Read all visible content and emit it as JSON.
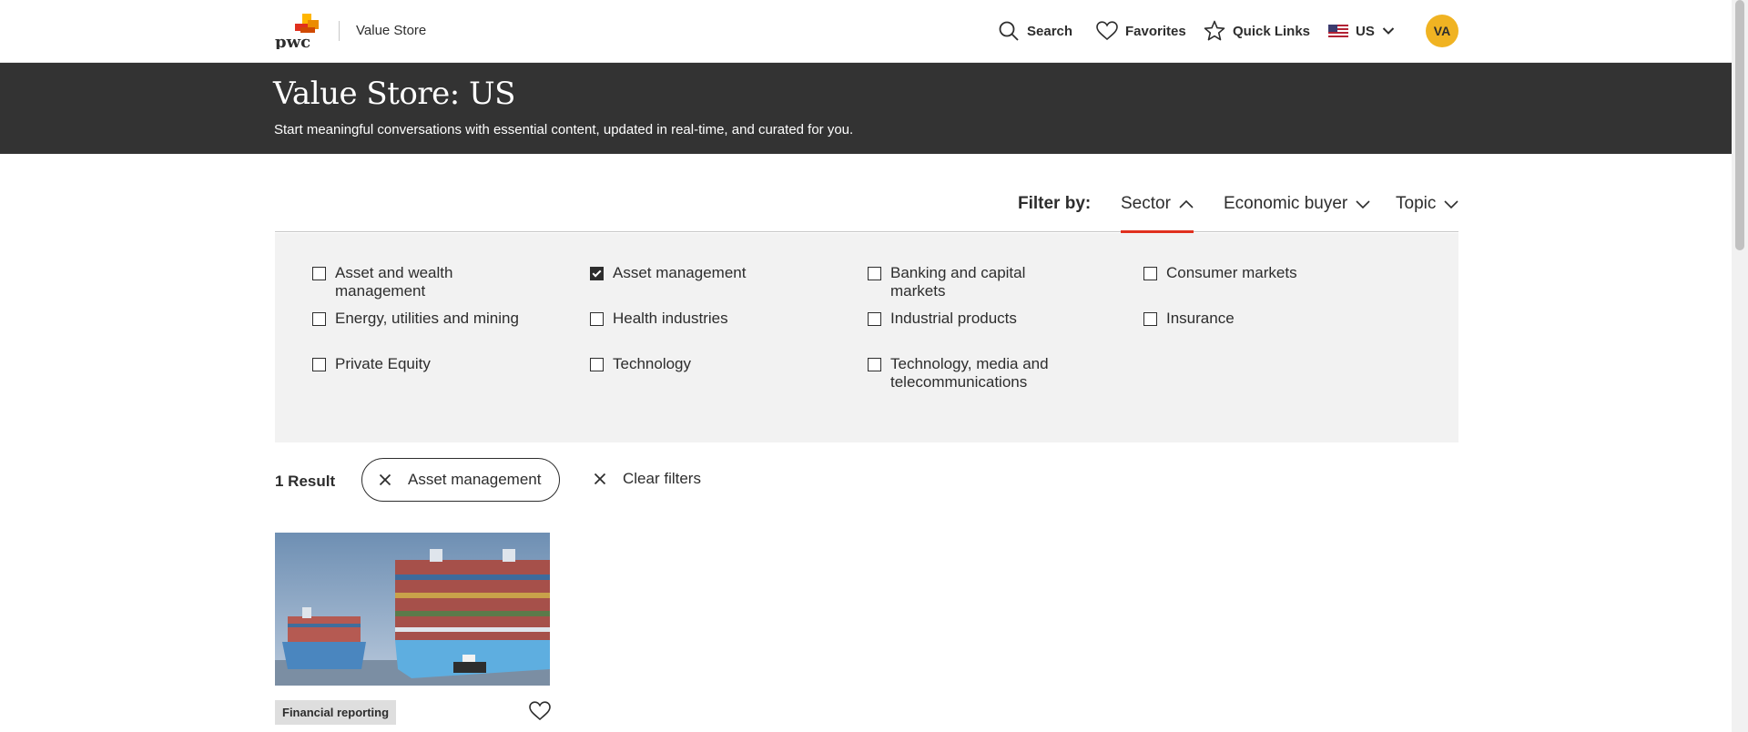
{
  "header": {
    "brand_label": "Value Store",
    "nav": {
      "search": "Search",
      "favorites": "Favorites",
      "quick_links": "Quick Links",
      "country": "US"
    },
    "avatar_initials": "VA"
  },
  "hero": {
    "title": "Value Store: US",
    "subtitle": "Start meaningful conversations with essential content, updated in real-time, and curated for you."
  },
  "filters": {
    "label": "Filter by:",
    "tabs": [
      {
        "label": "Sector",
        "expanded": true
      },
      {
        "label": "Economic buyer",
        "expanded": false
      },
      {
        "label": "Topic",
        "expanded": false
      }
    ],
    "sector_options": [
      {
        "label": "Asset and wealth management",
        "checked": false
      },
      {
        "label": "Asset management",
        "checked": true
      },
      {
        "label": "Banking and capital markets",
        "checked": false
      },
      {
        "label": "Consumer markets",
        "checked": false
      },
      {
        "label": "Energy, utilities and mining",
        "checked": false
      },
      {
        "label": "Health industries",
        "checked": false
      },
      {
        "label": "Industrial products",
        "checked": false
      },
      {
        "label": "Insurance",
        "checked": false
      },
      {
        "label": "Private Equity",
        "checked": false
      },
      {
        "label": "Technology",
        "checked": false
      },
      {
        "label": "Technology, media and telecommunications",
        "checked": false
      }
    ]
  },
  "results": {
    "count_label": "1 Result",
    "active_filter": "Asset management",
    "clear_label": "Clear filters"
  },
  "card": {
    "tag": "Financial reporting"
  },
  "colors": {
    "hero_bg": "#333333",
    "accent": "#e0301e",
    "avatar": "#f0b322",
    "panel_bg": "#f2f2f2"
  }
}
